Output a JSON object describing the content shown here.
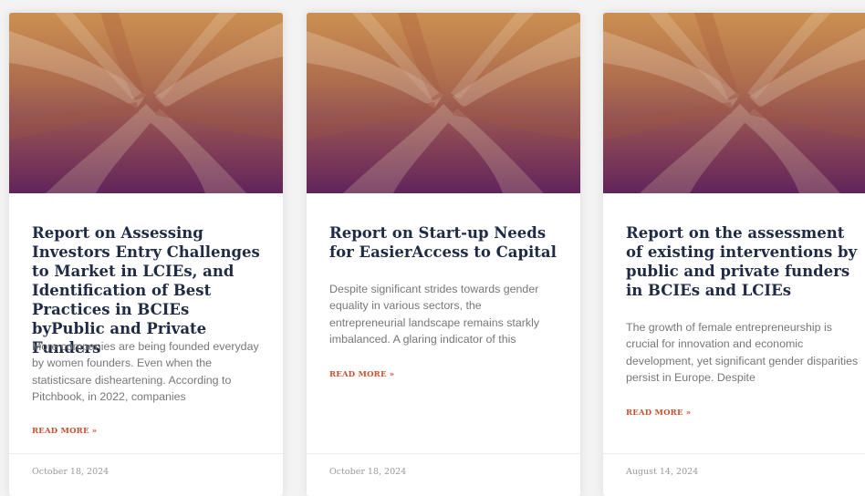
{
  "posts": [
    {
      "title": "Report on Assessing Investors Entry Challenges to Market in LCIEs, and Identification of Best Practices in BCIEs byPublic and Private Funders",
      "excerpt": "More companies are being founded everyday by women founders. Even when the statisticsare disheartening. According to Pitchbook, in 2022, companies",
      "read_more": "Read More »",
      "date": "October 18, 2024"
    },
    {
      "title": "Report on Start-up Needs for EasierAccess to Capital",
      "excerpt": "Despite significant strides towards gender equality in various sectors, the entrepreneurial landscape remains starkly imbalanced. A glaring indicator of this",
      "read_more": "Read More »",
      "date": "October 18, 2024"
    },
    {
      "title": "Report on the assessment of existing interventions by public and private funders in BCIEs and LCIEs",
      "excerpt": "The growth of female entrepreneurship is crucial for innovation and economic development, yet significant gender disparities persist in Europe. Despite",
      "read_more": "Read More »",
      "date": "August 14, 2024"
    }
  ],
  "colors": {
    "title": "#1f2a44",
    "excerpt": "#777777",
    "read_more": "#c9502e",
    "date": "#9a9a9a"
  }
}
